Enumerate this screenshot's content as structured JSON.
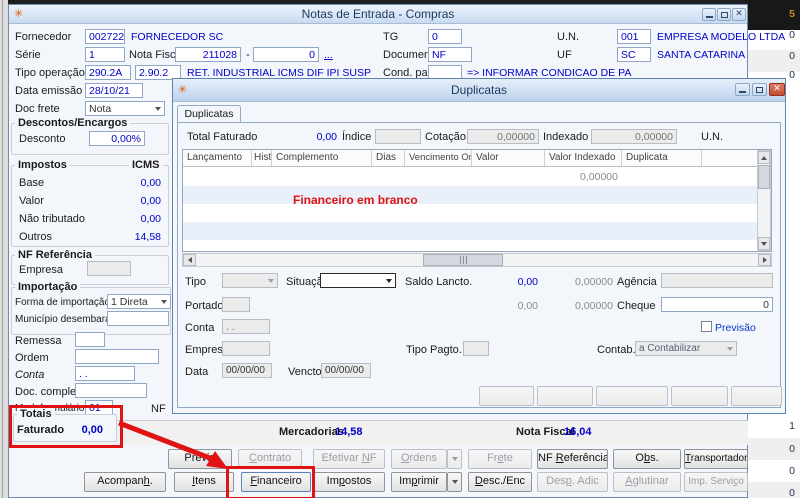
{
  "icons": {
    "app": "✳",
    "close": "✕"
  },
  "background": {
    "top_value": "5",
    "right_top": [
      "0",
      "0",
      "0"
    ],
    "right_bottom": [
      "1",
      "0",
      "0",
      "0"
    ]
  },
  "window": {
    "title": "Notas de Entrada - Compras",
    "row1": {
      "fornecedor_label": "Fornecedor",
      "fornecedor_code": "002722",
      "fornecedor_name": "FORNECEDOR SC",
      "tg_label": "TG",
      "tg_value": "0",
      "un_label": "U.N.",
      "un_code": "001",
      "un_name": "EMPRESA MODELO LTDA"
    },
    "row2": {
      "serie_label": "Série",
      "serie_value": "1",
      "nf_label": "Nota Fiscal",
      "nf_value": "211028",
      "dash": "-",
      "nf_sub": "0",
      "more": "...",
      "documento_label": "Documento",
      "documento_value": "NF",
      "uf_label": "UF",
      "uf_code": "SC",
      "uf_name": "SANTA CATARINA"
    },
    "row3": {
      "tipo_label": "Tipo operação",
      "tipo_code": "290.2A",
      "tipo_code2": "2.90.2",
      "tipo_desc": "RET. INDUSTRIAL ICMS DIF IPI SUSP",
      "cond_label": "Cond. pag.",
      "cond_hint": "=> INFORMAR CONDICAO DE PA"
    },
    "row4": {
      "data_label": "Data emissão",
      "data_value": "28/10/21"
    },
    "row5": {
      "frete_label": "Doc frete",
      "frete_value": "Nota"
    },
    "descontos": {
      "title": "Descontos/Encargos",
      "desconto_label": "Desconto",
      "desconto_value": "0,00%"
    },
    "impostos": {
      "title": "Impostos",
      "col": "ICMS",
      "rows": [
        {
          "label": "Base",
          "value": "0,00"
        },
        {
          "label": "Valor",
          "value": "0,00"
        },
        {
          "label": "Não tributado",
          "value": "0,00"
        },
        {
          "label": "Outros",
          "value": "14,58"
        }
      ]
    },
    "nf_ref": {
      "title": "NF Referência",
      "empresa_label": "Empresa"
    },
    "importacao": {
      "title": "Importação",
      "forma_label": "Forma de importação",
      "forma_value": "1 Direta",
      "municipio_label": "Município desembaraço"
    },
    "fields2": {
      "remessa_label": "Remessa",
      "ordem_label": "Ordem",
      "conta_label": "Conta",
      "conta_value": ". .",
      "doc_label": "Doc. completo",
      "mod_label": "Mod. formulário",
      "mod_value": "01",
      "nf_clip": "NF"
    },
    "totais": {
      "title": "Totais",
      "faturado_label": "Faturado",
      "faturado_value": "0,00"
    },
    "totals_bar": {
      "mercadorias_label": "Mercadorias",
      "mercadorias_value": "14,58",
      "nf_label": "Nota Fiscal",
      "nf_value": "16,04"
    },
    "buttons_row1": [
      {
        "pre": "Prévia",
        "acc": "",
        "post": ""
      },
      {
        "pre": "",
        "acc": "C",
        "post": "ontrato"
      },
      {
        "pre": "Efetivar ",
        "acc": "N",
        "post": "F"
      },
      {
        "pre": "",
        "acc": "O",
        "post": "rdens"
      },
      {
        "pre": "Fr",
        "acc": "e",
        "post": "te"
      },
      {
        "pre": "NF ",
        "acc": "R",
        "post": "eferência"
      },
      {
        "pre": "O",
        "acc": "b",
        "post": "s."
      },
      {
        "pre": "",
        "acc": "T",
        "post": "ransportadora"
      }
    ],
    "buttons_row2": [
      {
        "pre": "Acompan",
        "acc": "h",
        "post": "."
      },
      {
        "pre": "",
        "acc": "I",
        "post": "tens"
      },
      {
        "pre": "",
        "acc": "F",
        "post": "inanceiro"
      },
      {
        "pre": "Im",
        "acc": "p",
        "post": "ostos"
      },
      {
        "pre": "Im",
        "acc": "p",
        "post": "rimir"
      },
      {
        "pre": "",
        "acc": "D",
        "post": "esc./Enc"
      },
      {
        "pre": "Des",
        "acc": "p",
        "post": ". Adic"
      },
      {
        "pre": "",
        "acc": "A",
        "post": "glutinar"
      },
      {
        "pre": "Imp. Servi",
        "acc": "ç",
        "post": "o"
      }
    ]
  },
  "dialog": {
    "title": "Duplicatas",
    "tab_label": "Duplicatas",
    "header": {
      "total_label": "Total Faturado",
      "total_value": "0,00",
      "indice_label": "Índice",
      "cotacao_label": "Cotação",
      "cotacao_value": "0,00000",
      "indexado_label": "Indexado",
      "indexado_value": "0,00000",
      "un_label": "U.N."
    },
    "grid": {
      "columns": [
        "Lançamento",
        "Hist.",
        "Complemento",
        "Dias",
        "Vencimento Orig.",
        "Valor",
        "Valor Indexado",
        "Duplicata"
      ],
      "row1": {
        "valor_indexado": "0,00000"
      },
      "annotation": "Financeiro em branco"
    },
    "form": {
      "tipo_label": "Tipo",
      "situacao_label": "Situação",
      "saldo_label": "Saldo Lancto.",
      "saldo_value": "0,00",
      "saldo_indexado": "0,00000",
      "agencia_label": "Agência",
      "portador_label": "Portador",
      "portador_value2": "0,00",
      "portador_indexado": "0,00000",
      "cheque_label": "Cheque",
      "cheque_value": "0",
      "conta_label": "Conta",
      "conta_value": ". .",
      "previsao_label": "Previsão",
      "empresa_label": "Empresa",
      "tipo_pagto_label": "Tipo Pagto.",
      "contab_label": "Contab.",
      "contab_value": "a Contabilizar",
      "data_label": "Data",
      "data_value": "00/00/00",
      "vencto_label": "Vencto.",
      "vencto_value": "00/00/00"
    }
  }
}
